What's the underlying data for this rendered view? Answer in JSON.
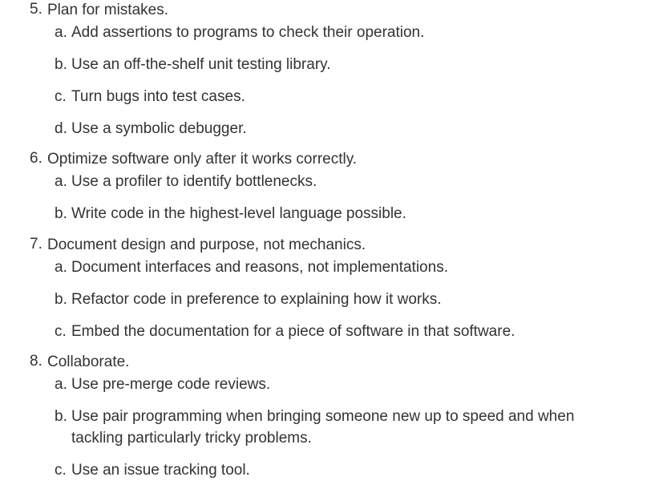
{
  "items": [
    {
      "num": "5.",
      "text": "Plan for mistakes.",
      "subs": [
        {
          "letter": "a.",
          "text": "Add assertions to programs to check their operation."
        },
        {
          "letter": "b.",
          "text": "Use an off-the-shelf unit testing library."
        },
        {
          "letter": "c.",
          "text": "Turn bugs into test cases."
        },
        {
          "letter": "d.",
          "text": "Use a symbolic debugger."
        }
      ]
    },
    {
      "num": "6.",
      "text": "Optimize software only after it works correctly.",
      "subs": [
        {
          "letter": "a.",
          "text": "Use a profiler to identify bottlenecks."
        },
        {
          "letter": "b.",
          "text": "Write code in the highest-level language possible."
        }
      ]
    },
    {
      "num": "7.",
      "text": "Document design and purpose, not mechanics.",
      "subs": [
        {
          "letter": "a.",
          "text": "Document interfaces and reasons, not implementations."
        },
        {
          "letter": "b.",
          "text": "Refactor code in preference to explaining how it works."
        },
        {
          "letter": "c.",
          "text": "Embed the documentation for a piece of software in that software."
        }
      ]
    },
    {
      "num": "8.",
      "text": "Collaborate.",
      "subs": [
        {
          "letter": "a.",
          "text": "Use pre-merge code reviews."
        },
        {
          "letter": "b.",
          "text": "Use pair programming when bringing someone new up to speed and when tackling particularly tricky problems."
        },
        {
          "letter": "c.",
          "text": "Use an issue tracking tool."
        }
      ]
    }
  ]
}
